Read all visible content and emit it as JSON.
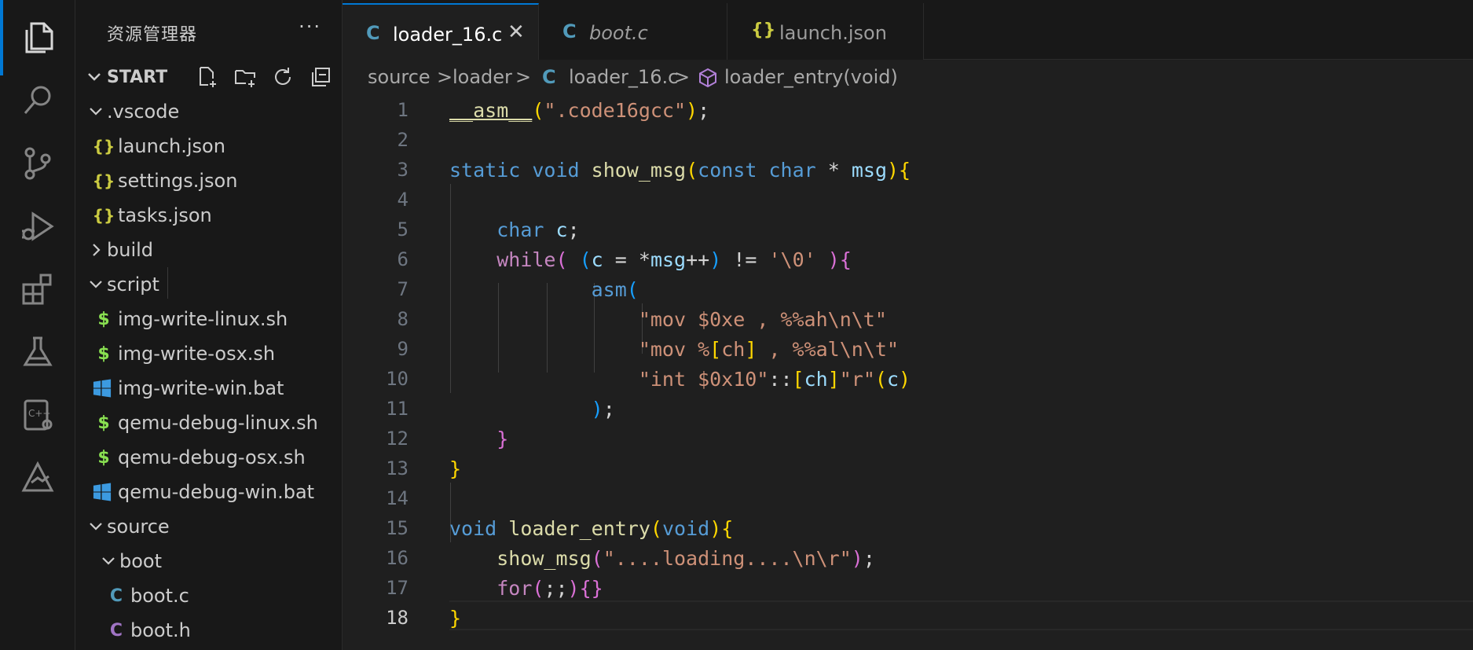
{
  "explorer": {
    "title": "资源管理器",
    "more": "···",
    "root": "START",
    "items": [
      {
        "label": ".vscode",
        "type": "folder-open"
      },
      {
        "label": "launch.json",
        "type": "json"
      },
      {
        "label": "settings.json",
        "type": "json"
      },
      {
        "label": "tasks.json",
        "type": "json"
      },
      {
        "label": "build",
        "type": "folder-closed"
      },
      {
        "label": "script",
        "type": "folder-open"
      },
      {
        "label": "img-write-linux.sh",
        "type": "shell"
      },
      {
        "label": "img-write-osx.sh",
        "type": "shell"
      },
      {
        "label": "img-write-win.bat",
        "type": "bat"
      },
      {
        "label": "qemu-debug-linux.sh",
        "type": "shell"
      },
      {
        "label": "qemu-debug-osx.sh",
        "type": "shell"
      },
      {
        "label": "qemu-debug-win.bat",
        "type": "bat"
      },
      {
        "label": "source",
        "type": "folder-open"
      },
      {
        "label": "boot",
        "type": "folder-open"
      },
      {
        "label": "boot.c",
        "type": "c"
      },
      {
        "label": "boot.h",
        "type": "h"
      }
    ]
  },
  "tabs": [
    {
      "label": "loader_16.c",
      "icon": "C",
      "active": true,
      "close": "✕"
    },
    {
      "label": "boot.c",
      "icon": "C",
      "active": false
    },
    {
      "label": "launch.json",
      "icon": "{}",
      "active": false
    }
  ],
  "breadcrumb": {
    "parts": [
      "source",
      "loader",
      "loader_16.c",
      "loader_entry(void)"
    ],
    "sep": ">",
    "c_icon": "C"
  },
  "editor": {
    "current_line": 18,
    "line_numbers": [
      "1",
      "2",
      "3",
      "4",
      "5",
      "6",
      "7",
      "8",
      "9",
      "10",
      "11",
      "12",
      "13",
      "14",
      "15",
      "16",
      "17",
      "18"
    ]
  },
  "colors": {
    "accent": "#0078d4",
    "c_icon": "#519aba",
    "h_icon": "#a074c4",
    "json_icon": "#cbcb41",
    "shell_icon": "#89e051",
    "bat_icon": "#3c9ae0"
  }
}
